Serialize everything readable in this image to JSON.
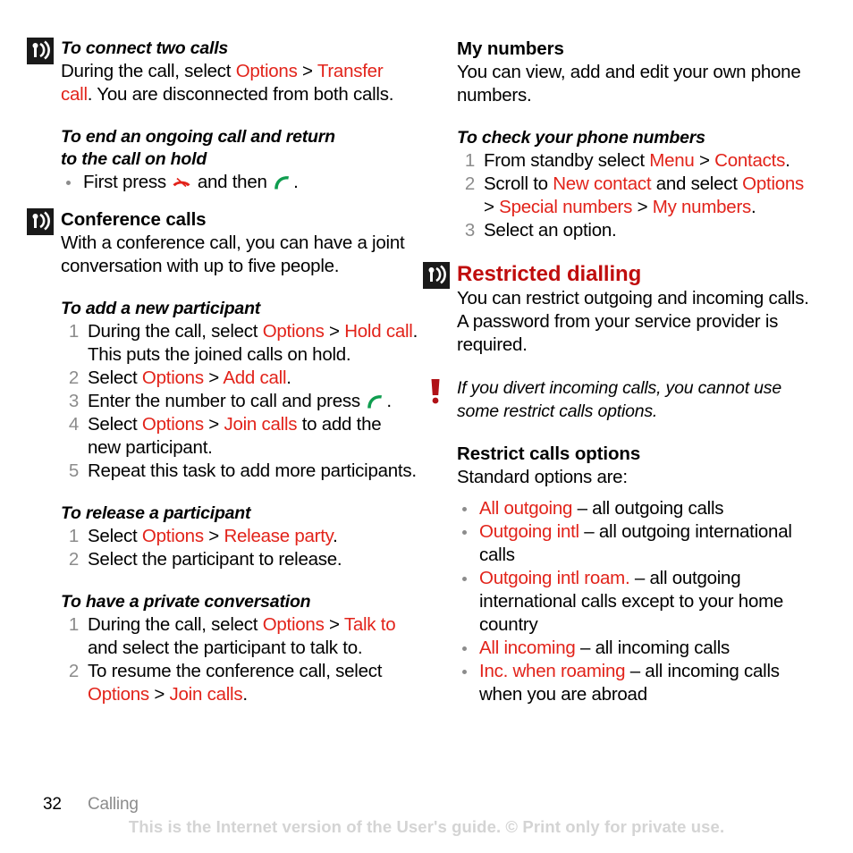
{
  "page": {
    "number": "32",
    "chapter": "Calling",
    "watermark": "This is the Internet version of the User's guide. © Print only for private use."
  },
  "colors": {
    "link_red": "#e2231a",
    "heading_red": "#c00d0d",
    "number_gray": "#8c8c8c",
    "watermark_gray": "#d4d4d4",
    "icon_black": "#1a1a1a",
    "call_green": "#0f9d4f"
  },
  "left_column": {
    "task_transfer": {
      "icon": "signal-antenna-icon",
      "heading": "To connect two calls",
      "body": {
        "p1": "During the call, select ",
        "link1": "Options",
        "p2": " > ",
        "link2": "Transfer call",
        "p3": ". You are disconnected from both calls."
      }
    },
    "task_end_call": {
      "heading_line1": "To end an ongoing call and return",
      "heading_line2": "to the call on hold",
      "bullet": {
        "p1": "First press ",
        "icon1": "end-call-key-icon",
        "p2": " and then ",
        "icon2": "call-key-icon",
        "p3": "."
      }
    },
    "conference": {
      "icon": "signal-antenna-icon",
      "heading": "Conference calls",
      "body": "With a conference call, you can have a joint conversation with up to five people."
    },
    "task_add_participant": {
      "heading": "To add a new participant",
      "steps": [
        {
          "parts": [
            {
              "t": "During the call, select ",
              "c": "black"
            },
            {
              "t": "Options",
              "c": "red"
            },
            {
              "t": " > ",
              "c": "black"
            },
            {
              "t": "Hold call",
              "c": "red"
            },
            {
              "t": ". This puts the joined calls on hold.",
              "c": "black"
            }
          ]
        },
        {
          "parts": [
            {
              "t": "Select ",
              "c": "black"
            },
            {
              "t": "Options",
              "c": "red"
            },
            {
              "t": " > ",
              "c": "black"
            },
            {
              "t": "Add call",
              "c": "red"
            },
            {
              "t": ".",
              "c": "black"
            }
          ]
        },
        {
          "parts": [
            {
              "t": "Enter the number to call and press ",
              "c": "black"
            },
            {
              "t": "call-key-icon",
              "c": "icon-call"
            },
            {
              "t": ".",
              "c": "black"
            }
          ]
        },
        {
          "parts": [
            {
              "t": "Select ",
              "c": "black"
            },
            {
              "t": "Options",
              "c": "red"
            },
            {
              "t": " > ",
              "c": "black"
            },
            {
              "t": "Join calls",
              "c": "red"
            },
            {
              "t": " to add the new participant.",
              "c": "black"
            }
          ]
        },
        {
          "parts": [
            {
              "t": "Repeat this task to add more participants.",
              "c": "black"
            }
          ]
        }
      ]
    },
    "task_release_participant": {
      "heading": "To release a participant",
      "steps": [
        {
          "parts": [
            {
              "t": "Select ",
              "c": "black"
            },
            {
              "t": "Options",
              "c": "red"
            },
            {
              "t": " > ",
              "c": "black"
            },
            {
              "t": "Release party",
              "c": "red"
            },
            {
              "t": ".",
              "c": "black"
            }
          ]
        },
        {
          "parts": [
            {
              "t": "Select the participant to release.",
              "c": "black"
            }
          ]
        }
      ]
    },
    "task_private_conversation": {
      "heading": "To have a private conversation",
      "steps": [
        {
          "parts": [
            {
              "t": "During the call, select ",
              "c": "black"
            },
            {
              "t": "Options",
              "c": "red"
            },
            {
              "t": " > ",
              "c": "black"
            },
            {
              "t": "Talk to",
              "c": "red"
            },
            {
              "t": " and select the participant to talk to.",
              "c": "black"
            }
          ]
        },
        {
          "parts": [
            {
              "t": "To resume the conference call, select ",
              "c": "black"
            },
            {
              "t": "Options",
              "c": "red"
            },
            {
              "t": " > ",
              "c": "black"
            },
            {
              "t": "Join calls",
              "c": "red"
            },
            {
              "t": ".",
              "c": "black"
            }
          ]
        }
      ]
    }
  },
  "right_column": {
    "my_numbers": {
      "heading": "My numbers",
      "body": "You can view, add and edit your own phone numbers."
    },
    "task_check_numbers": {
      "heading": "To check your phone numbers",
      "steps": [
        {
          "parts": [
            {
              "t": "From standby select ",
              "c": "black"
            },
            {
              "t": "Menu",
              "c": "red"
            },
            {
              "t": " > ",
              "c": "black"
            },
            {
              "t": "Contacts",
              "c": "red"
            },
            {
              "t": ".",
              "c": "black"
            }
          ]
        },
        {
          "parts": [
            {
              "t": "Scroll to ",
              "c": "black"
            },
            {
              "t": "New contact",
              "c": "red"
            },
            {
              "t": " and select ",
              "c": "black"
            },
            {
              "t": "Options",
              "c": "red"
            },
            {
              "t": " > ",
              "c": "black"
            },
            {
              "t": "Special numbers",
              "c": "red"
            },
            {
              "t": " > ",
              "c": "black"
            },
            {
              "t": "My numbers",
              "c": "red"
            },
            {
              "t": ".",
              "c": "black"
            }
          ]
        },
        {
          "parts": [
            {
              "t": "Select an option.",
              "c": "black"
            }
          ]
        }
      ]
    },
    "restricted_dialling": {
      "icon": "signal-antenna-icon",
      "heading": "Restricted dialling",
      "body": "You can restrict outgoing and incoming calls. A password from your service provider is required."
    },
    "note": {
      "icon": "exclamation-warning-icon",
      "text": "If you divert incoming calls, you cannot use some restrict calls options."
    },
    "restrict_options": {
      "heading": "Restrict calls options",
      "intro": "Standard options are:",
      "items": [
        {
          "term": "All outgoing",
          "desc": " – all outgoing calls"
        },
        {
          "term": "Outgoing intl",
          "desc": " – all outgoing international calls"
        },
        {
          "term": "Outgoing intl roam.",
          "desc": " – all outgoing international calls except to your home country"
        },
        {
          "term": "All incoming",
          "desc": " – all incoming calls"
        },
        {
          "term": "Inc. when roaming",
          "desc": " – all incoming calls when you are abroad"
        }
      ]
    }
  }
}
